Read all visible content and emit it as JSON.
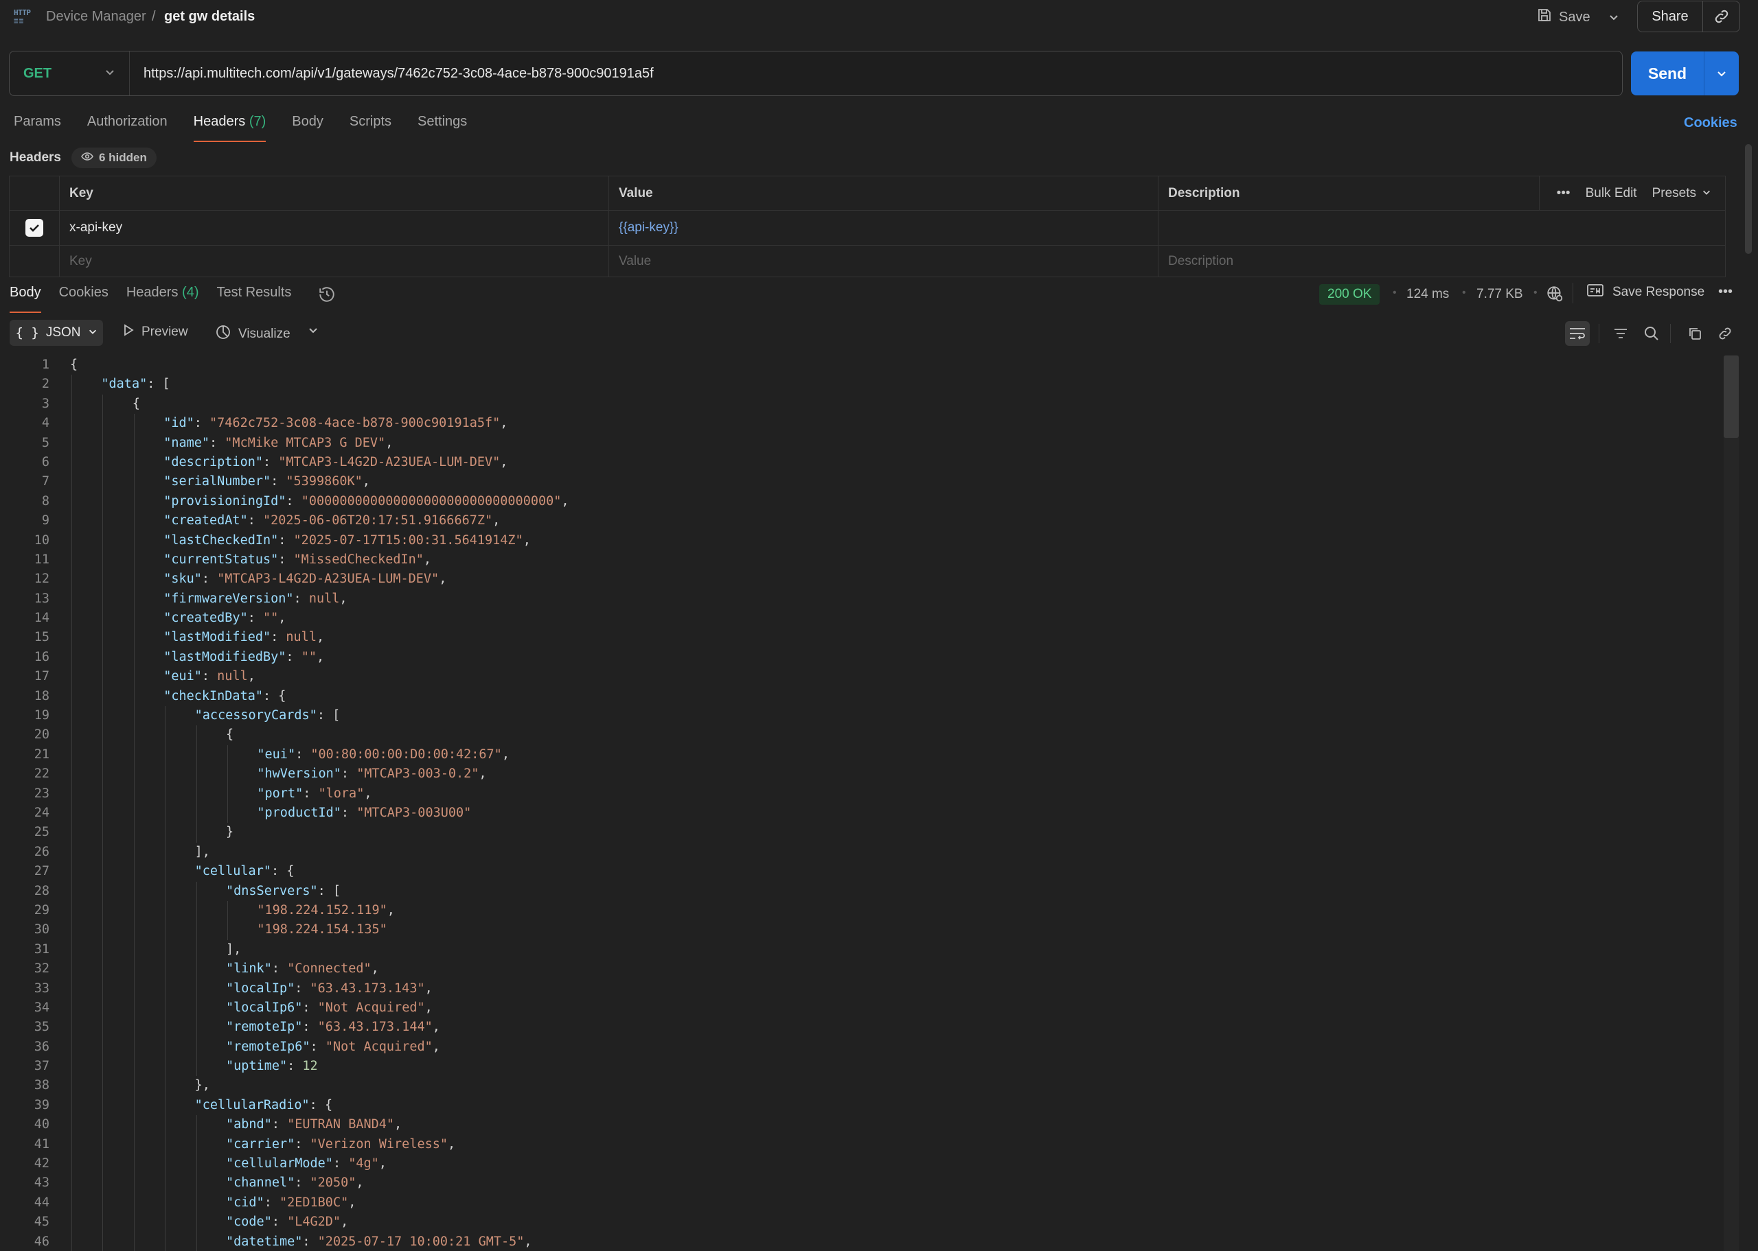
{
  "breadcrumb": {
    "parent": "Device Manager",
    "separator": "/",
    "current": "get gw details",
    "icon": "http-icon"
  },
  "actions": {
    "save": "Save",
    "share": "Share"
  },
  "request": {
    "method": "GET",
    "url": "https://api.multitech.com/api/v1/gateways/7462c752-3c08-4ace-b878-900c90191a5f",
    "send": "Send"
  },
  "req_tabs": [
    {
      "label": "Params"
    },
    {
      "label": "Authorization"
    },
    {
      "label": "Headers",
      "count": "(7)",
      "active": true
    },
    {
      "label": "Body"
    },
    {
      "label": "Scripts"
    },
    {
      "label": "Settings"
    }
  ],
  "cookies_link": "Cookies",
  "headers_section": {
    "title": "Headers",
    "hidden": "6 hidden",
    "columns": {
      "key": "Key",
      "value": "Value",
      "description": "Description"
    },
    "bulk_edit": "Bulk Edit",
    "presets": "Presets",
    "rows": [
      {
        "checked": true,
        "key": "x-api-key",
        "value": "{{api-key}}",
        "description": ""
      }
    ],
    "placeholders": {
      "key": "Key",
      "value": "Value",
      "description": "Description"
    }
  },
  "resp_tabs": [
    {
      "label": "Body",
      "active": true
    },
    {
      "label": "Cookies"
    },
    {
      "label": "Headers",
      "count": "(4)"
    },
    {
      "label": "Test Results"
    }
  ],
  "response_meta": {
    "status": "200 OK",
    "time": "124 ms",
    "size": "7.77 KB",
    "save_response": "Save Response",
    "status_color": "#5ed38d"
  },
  "format_toolbar": {
    "format": "JSON",
    "preview": "Preview",
    "visualize": "Visualize"
  },
  "code_lines": [
    [
      [
        "p",
        "{"
      ]
    ],
    [
      [
        "k",
        "\"data\""
      ],
      [
        "p",
        ": ["
      ]
    ],
    [
      [
        "p",
        "{"
      ]
    ],
    [
      [
        "k",
        "\"id\""
      ],
      [
        "p",
        ": "
      ],
      [
        "s",
        "\"7462c752-3c08-4ace-b878-900c90191a5f\""
      ],
      [
        "p",
        ","
      ]
    ],
    [
      [
        "k",
        "\"name\""
      ],
      [
        "p",
        ": "
      ],
      [
        "s",
        "\"McMike MTCAP3 G DEV\""
      ],
      [
        "p",
        ","
      ]
    ],
    [
      [
        "k",
        "\"description\""
      ],
      [
        "p",
        ": "
      ],
      [
        "s",
        "\"MTCAP3-L4G2D-A23UEA-LUM-DEV\""
      ],
      [
        "p",
        ","
      ]
    ],
    [
      [
        "k",
        "\"serialNumber\""
      ],
      [
        "p",
        ": "
      ],
      [
        "s",
        "\"5399860K\""
      ],
      [
        "p",
        ","
      ]
    ],
    [
      [
        "k",
        "\"provisioningId\""
      ],
      [
        "p",
        ": "
      ],
      [
        "s",
        "\"00000000000000000000000000000000\""
      ],
      [
        "p",
        ","
      ]
    ],
    [
      [
        "k",
        "\"createdAt\""
      ],
      [
        "p",
        ": "
      ],
      [
        "s",
        "\"2025-06-06T20:17:51.9166667Z\""
      ],
      [
        "p",
        ","
      ]
    ],
    [
      [
        "k",
        "\"lastCheckedIn\""
      ],
      [
        "p",
        ": "
      ],
      [
        "s",
        "\"2025-07-17T15:00:31.5641914Z\""
      ],
      [
        "p",
        ","
      ]
    ],
    [
      [
        "k",
        "\"currentStatus\""
      ],
      [
        "p",
        ": "
      ],
      [
        "s",
        "\"MissedCheckedIn\""
      ],
      [
        "p",
        ","
      ]
    ],
    [
      [
        "k",
        "\"sku\""
      ],
      [
        "p",
        ": "
      ],
      [
        "s",
        "\"MTCAP3-L4G2D-A23UEA-LUM-DEV\""
      ],
      [
        "p",
        ","
      ]
    ],
    [
      [
        "k",
        "\"firmwareVersion\""
      ],
      [
        "p",
        ": "
      ],
      [
        "nl",
        "null"
      ],
      [
        "p",
        ","
      ]
    ],
    [
      [
        "k",
        "\"createdBy\""
      ],
      [
        "p",
        ": "
      ],
      [
        "s",
        "\"\""
      ],
      [
        "p",
        ","
      ]
    ],
    [
      [
        "k",
        "\"lastModified\""
      ],
      [
        "p",
        ": "
      ],
      [
        "nl",
        "null"
      ],
      [
        "p",
        ","
      ]
    ],
    [
      [
        "k",
        "\"lastModifiedBy\""
      ],
      [
        "p",
        ": "
      ],
      [
        "s",
        "\"\""
      ],
      [
        "p",
        ","
      ]
    ],
    [
      [
        "k",
        "\"eui\""
      ],
      [
        "p",
        ": "
      ],
      [
        "nl",
        "null"
      ],
      [
        "p",
        ","
      ]
    ],
    [
      [
        "k",
        "\"checkInData\""
      ],
      [
        "p",
        ": {"
      ]
    ],
    [
      [
        "k",
        "\"accessoryCards\""
      ],
      [
        "p",
        ": ["
      ]
    ],
    [
      [
        "p",
        "{"
      ]
    ],
    [
      [
        "k",
        "\"eui\""
      ],
      [
        "p",
        ": "
      ],
      [
        "s",
        "\"00:80:00:00:D0:00:42:67\""
      ],
      [
        "p",
        ","
      ]
    ],
    [
      [
        "k",
        "\"hwVersion\""
      ],
      [
        "p",
        ": "
      ],
      [
        "s",
        "\"MTCAP3-003-0.2\""
      ],
      [
        "p",
        ","
      ]
    ],
    [
      [
        "k",
        "\"port\""
      ],
      [
        "p",
        ": "
      ],
      [
        "s",
        "\"lora\""
      ],
      [
        "p",
        ","
      ]
    ],
    [
      [
        "k",
        "\"productId\""
      ],
      [
        "p",
        ": "
      ],
      [
        "s",
        "\"MTCAP3-003U00\""
      ]
    ],
    [
      [
        "p",
        "}"
      ]
    ],
    [
      [
        "p",
        "],"
      ]
    ],
    [
      [
        "k",
        "\"cellular\""
      ],
      [
        "p",
        ": {"
      ]
    ],
    [
      [
        "k",
        "\"dnsServers\""
      ],
      [
        "p",
        ": ["
      ]
    ],
    [
      [
        "s",
        "\"198.224.152.119\""
      ],
      [
        "p",
        ","
      ]
    ],
    [
      [
        "s",
        "\"198.224.154.135\""
      ]
    ],
    [
      [
        "p",
        "],"
      ]
    ],
    [
      [
        "k",
        "\"link\""
      ],
      [
        "p",
        ": "
      ],
      [
        "s",
        "\"Connected\""
      ],
      [
        "p",
        ","
      ]
    ],
    [
      [
        "k",
        "\"localIp\""
      ],
      [
        "p",
        ": "
      ],
      [
        "s",
        "\"63.43.173.143\""
      ],
      [
        "p",
        ","
      ]
    ],
    [
      [
        "k",
        "\"localIp6\""
      ],
      [
        "p",
        ": "
      ],
      [
        "s",
        "\"Not Acquired\""
      ],
      [
        "p",
        ","
      ]
    ],
    [
      [
        "k",
        "\"remoteIp\""
      ],
      [
        "p",
        ": "
      ],
      [
        "s",
        "\"63.43.173.144\""
      ],
      [
        "p",
        ","
      ]
    ],
    [
      [
        "k",
        "\"remoteIp6\""
      ],
      [
        "p",
        ": "
      ],
      [
        "s",
        "\"Not Acquired\""
      ],
      [
        "p",
        ","
      ]
    ],
    [
      [
        "k",
        "\"uptime\""
      ],
      [
        "p",
        ": "
      ],
      [
        "n",
        "12"
      ]
    ],
    [
      [
        "p",
        "},"
      ]
    ],
    [
      [
        "k",
        "\"cellularRadio\""
      ],
      [
        "p",
        ": {"
      ]
    ],
    [
      [
        "k",
        "\"abnd\""
      ],
      [
        "p",
        ": "
      ],
      [
        "s",
        "\"EUTRAN BAND4\""
      ],
      [
        "p",
        ","
      ]
    ],
    [
      [
        "k",
        "\"carrier\""
      ],
      [
        "p",
        ": "
      ],
      [
        "s",
        "\"Verizon Wireless\""
      ],
      [
        "p",
        ","
      ]
    ],
    [
      [
        "k",
        "\"cellularMode\""
      ],
      [
        "p",
        ": "
      ],
      [
        "s",
        "\"4g\""
      ],
      [
        "p",
        ","
      ]
    ],
    [
      [
        "k",
        "\"channel\""
      ],
      [
        "p",
        ": "
      ],
      [
        "s",
        "\"2050\""
      ],
      [
        "p",
        ","
      ]
    ],
    [
      [
        "k",
        "\"cid\""
      ],
      [
        "p",
        ": "
      ],
      [
        "s",
        "\"2ED1B0C\""
      ],
      [
        "p",
        ","
      ]
    ],
    [
      [
        "k",
        "\"code\""
      ],
      [
        "p",
        ": "
      ],
      [
        "s",
        "\"L4G2D\""
      ],
      [
        "p",
        ","
      ]
    ],
    [
      [
        "k",
        "\"datetime\""
      ],
      [
        "p",
        ": "
      ],
      [
        "s",
        "\"2025-07-17 10:00:21 GMT-5\""
      ],
      [
        "p",
        ","
      ]
    ]
  ],
  "code_indents": [
    0,
    1,
    2,
    3,
    3,
    3,
    3,
    3,
    3,
    3,
    3,
    3,
    3,
    3,
    3,
    3,
    3,
    3,
    4,
    5,
    6,
    6,
    6,
    6,
    5,
    4,
    4,
    5,
    6,
    6,
    5,
    5,
    5,
    5,
    5,
    5,
    5,
    4,
    4,
    5,
    5,
    5,
    5,
    5,
    5,
    5
  ]
}
